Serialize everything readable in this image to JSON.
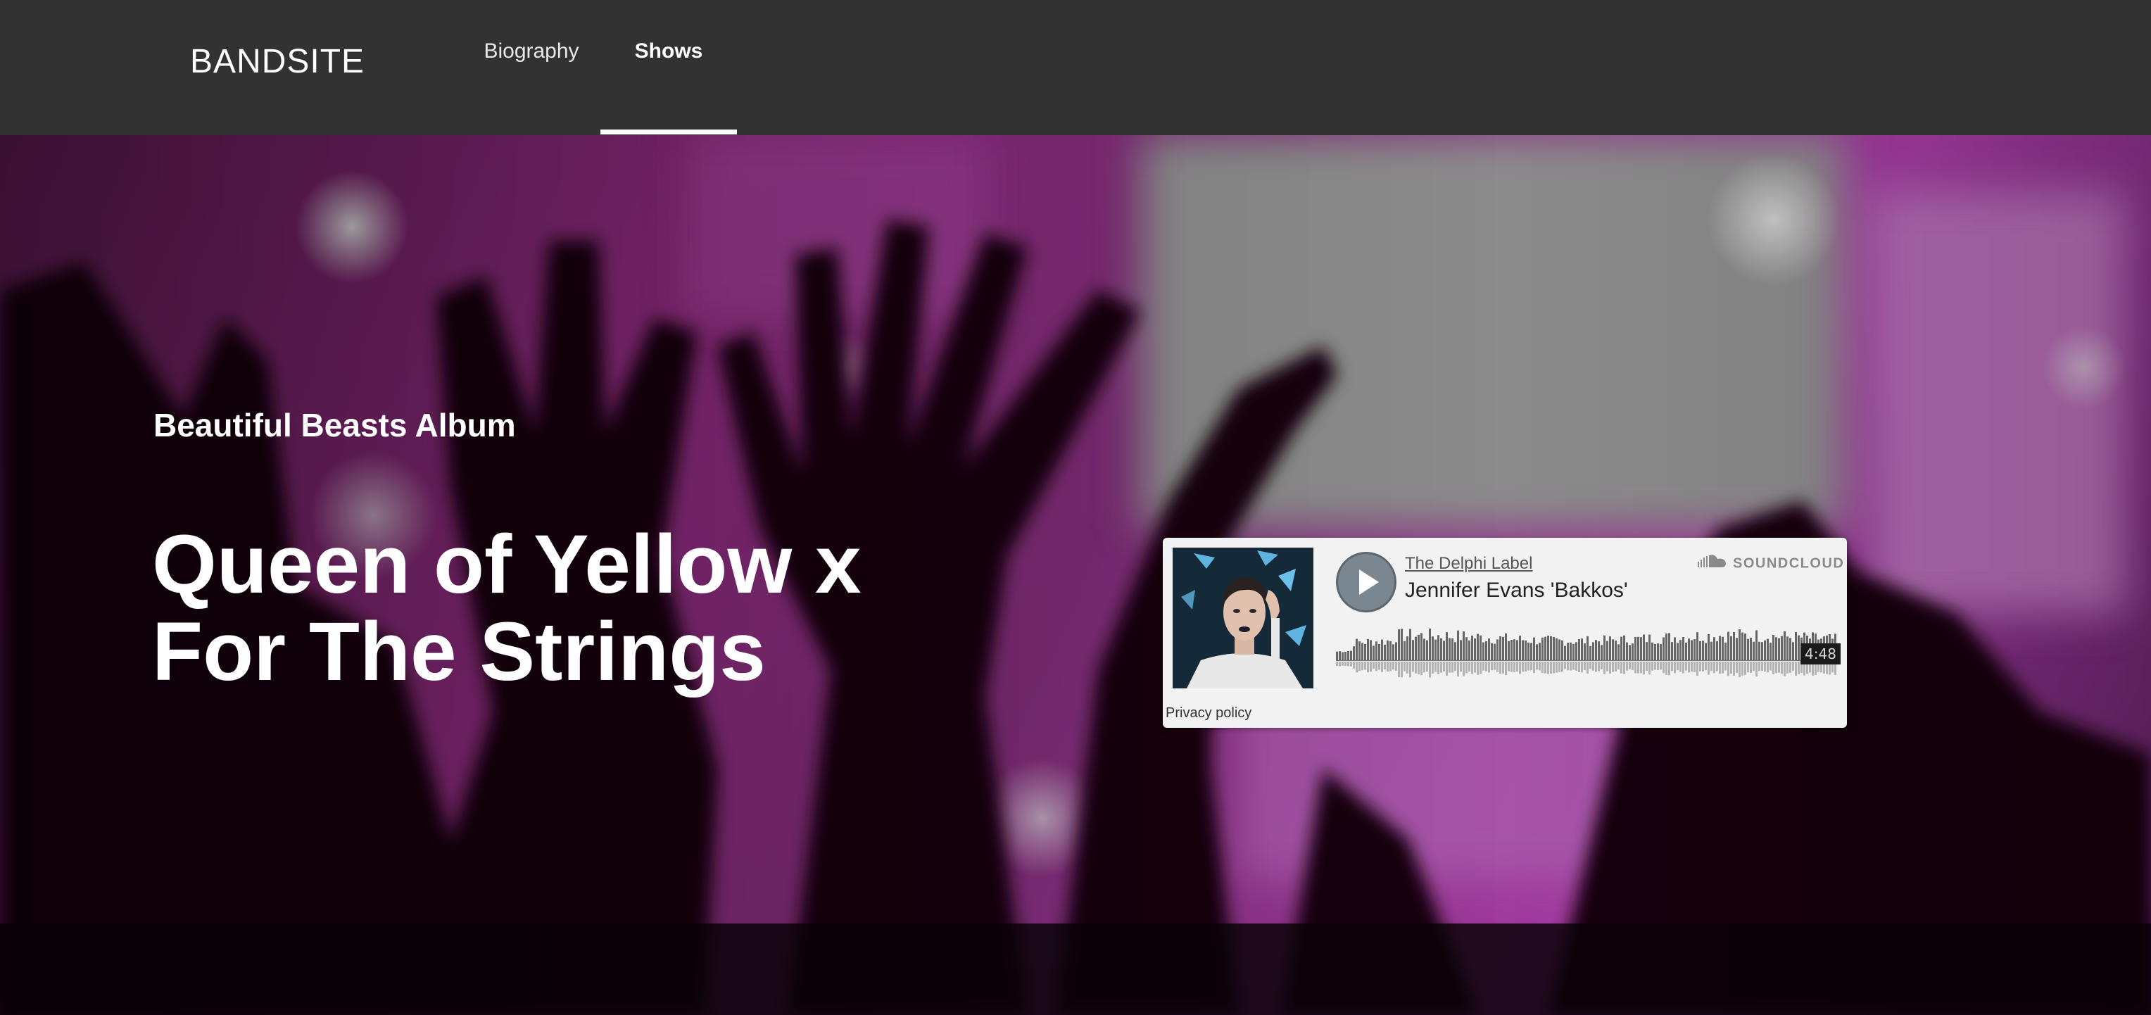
{
  "header": {
    "logo": "BANDSITE",
    "nav": [
      {
        "label": "Biography",
        "active": false
      },
      {
        "label": "Shows",
        "active": true
      }
    ]
  },
  "hero": {
    "subtitle": "Beautiful Beasts Album",
    "title_lines": [
      "Queen of Yellow x",
      "For The Strings"
    ]
  },
  "player": {
    "brand": "SOUNDCLOUD",
    "artist": "The Delphi Label",
    "track": "Jennifer Evans 'Bakkos'",
    "duration": "4:48",
    "privacy": "Privacy policy",
    "progress": 0,
    "icons": [
      "play-icon",
      "soundcloud-icon"
    ]
  },
  "colors": {
    "header_bg": "#323232",
    "hero_tint": "#8a2a7c",
    "widget_bg": "#f2f2f2"
  }
}
